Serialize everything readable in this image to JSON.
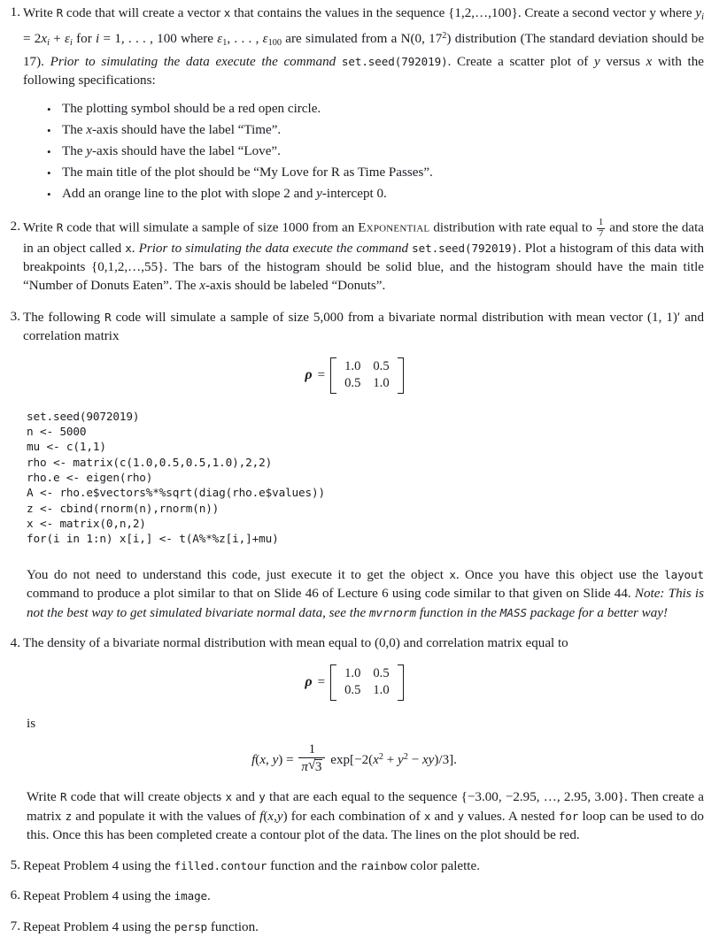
{
  "document": {
    "type": "homework-problem-set",
    "font_color": "#1a1a22",
    "background": "#ffffff"
  },
  "problems": [
    {
      "number": "1.",
      "text_parts": [
        "Write ",
        "R",
        " code that will create a vector ",
        "x",
        " that contains the values in the sequence {1, 2, . . . , 100}. Create a second vector y where ",
        "y_i = 2x_i + e_i",
        " for ",
        "i = 1, . . . , 100",
        " where ",
        "e_1, . . . , e_100",
        " are simulated from a ",
        "N(0, 17^2)",
        " distribution (The standard deviation should be 17). ",
        "Prior to simulating the data execute the command ",
        "set.seed(792019)",
        ". Create a scatter plot of ",
        "y",
        " versus ",
        "x",
        " with the following specifications:"
      ],
      "inline_code_1": "R",
      "inline_code_2": "x",
      "italic_note": "Prior to simulating the data execute the command",
      "seed_command": "set.seed(792019)",
      "bullets": [
        {
          "text": "The plotting symbol should be a red open circle."
        },
        {
          "text": "The x-axis should have the label “Time”."
        },
        {
          "text": "The y-axis should have the label “Love”."
        },
        {
          "text": "The main title of the plot should be “My Love for R as Time Passes”."
        },
        {
          "text": "Add an orange line to the plot with slope 2 and y-intercept 0."
        }
      ]
    },
    {
      "number": "2.",
      "distribution_name": "Exponential",
      "sample_size": "1000",
      "rate_num": "1",
      "rate_den": "7",
      "object_name": "x",
      "seed_command": "set.seed(792019)",
      "italic_note": "Prior to simulating the data execute the command",
      "breakpoints": "{0, 1, 2, . . . , 55}",
      "bar_color": "solid blue",
      "main_title": "“Number of Donuts Eaten”",
      "x_axis_label": "“Donuts”"
    },
    {
      "number": "3.",
      "sample_size": "5,000",
      "mean_vector": "(1, 1)′",
      "matrix": {
        "symbol": "ρ",
        "rows": [
          [
            "1.0",
            "0.5"
          ],
          [
            "0.5",
            "1.0"
          ]
        ]
      },
      "code": "set.seed(9072019)\nn <- 5000\nmu <- c(1,1)\nrho <- matrix(c(1.0,0.5,0.5,1.0),2,2)\nrho.e <- eigen(rho)\nA <- rho.e$vectors%*%sqrt(diag(rho.e$values))\nz <- cbind(rnorm(n),rnorm(n))\nx <- matrix(0,n,2)\nfor(i in 1:n) x[i,] <- t(A%*%z[i,]+mu)",
      "after_code": {
        "object": "x",
        "layout_command": "layout",
        "slide_plot": "Slide 46 of Lecture 6",
        "slide_code": "Slide 44",
        "note_prefix": "Note:",
        "note_text_1": "This is not the best way to get simulated bivariate normal data, see the",
        "note_fn": "mvrnorm",
        "note_text_2": "function in the",
        "note_pkg": "MASS",
        "note_text_3": "package for a better way!"
      }
    },
    {
      "number": "4.",
      "mean": "(0, 0)",
      "matrix": {
        "symbol": "ρ",
        "rows": [
          [
            "1.0",
            "0.5"
          ],
          [
            "0.5",
            "1.0"
          ]
        ]
      },
      "is_word": "is",
      "density": {
        "lhs": "f(x, y) =",
        "frac_num": "1",
        "frac_den_pi": "π",
        "frac_den_sqrt": "3",
        "exp_body": "exp[−2(x² + y² − xy)/3]."
      },
      "sequence": "{−3.00, −2.95, . . . , 2.95, 3.00}",
      "objects": [
        "x",
        "y"
      ],
      "matrix_object": "z",
      "loop_keyword": "for",
      "plot_type": "contour plot",
      "line_color": "red"
    },
    {
      "number": "5.",
      "text_before": "Repeat Problem 4 using the",
      "function": "filled.contour",
      "text_middle": "function and the",
      "palette": "rainbow",
      "text_after": "color palette."
    },
    {
      "number": "6.",
      "text_before": "Repeat Problem 4 using the",
      "function": "image",
      "text_after": "."
    },
    {
      "number": "7.",
      "text_before": "Repeat Problem 4 using the",
      "function": "persp",
      "text_after": "function."
    }
  ],
  "strings": {
    "p1_s1": "Write",
    "p1_s2": "code that will create a vector",
    "p1_s3": "that contains the values in the sequence {1,2,…,100}. Create a second vector y where",
    "p1_s4": "for",
    "p1_s5": "where",
    "p1_s6": "are simulated from a",
    "p1_s7": "distribution (The standard deviation should be 17).",
    "p1_s8": ". Create a scatter plot of",
    "p1_s9": "versus",
    "p1_s10": "with the following specifications:",
    "p2_s1": "Write",
    "p2_s2": "code that will simulate a sample of size 1000 from an",
    "p2_s3": "distribution with rate equal to",
    "p2_s4": "and store the data in an object called",
    "p2_s5": ".",
    "p2_s6": ". Plot a histogram of this data with breakpoints {0,1,2,…,55}. The bars of the histogram should be solid blue, and the histogram should have the main title “Number of Donuts Eaten”. The",
    "p2_s7": "-axis should be labeled “Donuts”.",
    "p3_s1": "The following",
    "p3_s2": "code will simulate a sample of size 5,000 from a bivariate normal distribution with mean vector",
    "p3_s3": "and correlation matrix",
    "p3_s4": "You do not need to understand this code, just execute it to get the object",
    "p3_s5": ". Once you have this object use the",
    "p3_s6": "command to produce a plot similar to that on Slide 46 of Lecture 6 using code similar to that given on Slide 44.",
    "p4_s1": "The density of a bivariate normal distribution with mean equal to (0,0) and correlation matrix equal to",
    "p4_s2": "Write",
    "p4_s3": "code that will create objects",
    "p4_s4": "and",
    "p4_s5": "that are each equal to the sequence {−3.00, −2.95, …, 2.95, 3.00}. Then create a matrix",
    "p4_s6": "and populate it with the values of",
    "p4_s7": "for each combination of",
    "p4_s8": "and",
    "p4_s9": "values. A nested",
    "p4_s10": "loop can be used to do this. Once this has been completed create a contour plot of the data. The lines on the plot should be red.",
    "rcode": "R"
  }
}
